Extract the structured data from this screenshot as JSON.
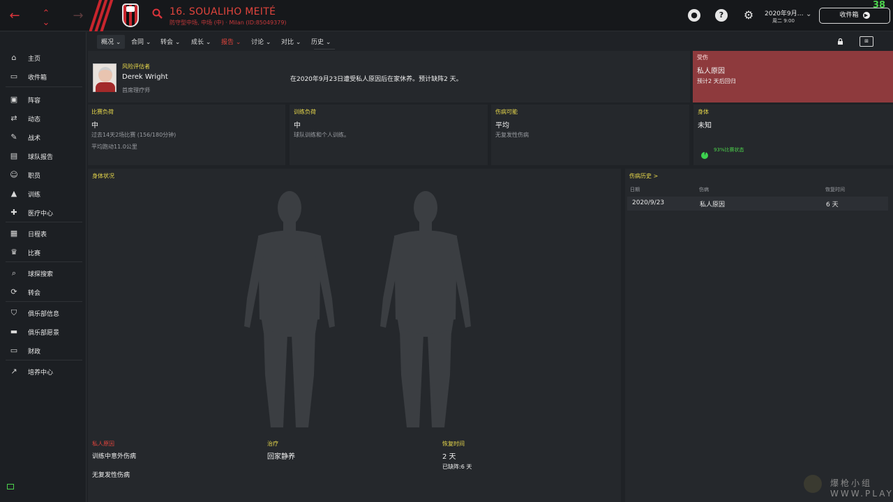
{
  "header": {
    "player_name": "16. SOUALIHO MEITÉ",
    "player_subtitle": "防守型中场, 中场 (中) · Milan (ID:85049379)",
    "date": "2020年9月…",
    "weekday_time": "周二 9:00",
    "inbox_label": "收件箱",
    "counter": "38",
    "icons": [
      "back-arrow-icon",
      "up-down-arrow-icon",
      "forward-arrow-icon",
      "club-crest",
      "search-icon",
      "ball-icon",
      "help-icon",
      "settings-gear-icon"
    ]
  },
  "sidebar": {
    "items": [
      {
        "label": "主页",
        "icon": "home-icon"
      },
      {
        "label": "收件箱",
        "icon": "inbox-icon"
      },
      {
        "label": "阵容",
        "icon": "shirt-icon"
      },
      {
        "label": "动态",
        "icon": "dynamics-icon"
      },
      {
        "label": "战术",
        "icon": "tactics-icon"
      },
      {
        "label": "球队报告",
        "icon": "report-icon"
      },
      {
        "label": "职员",
        "icon": "staff-icon"
      },
      {
        "label": "训练",
        "icon": "training-icon"
      },
      {
        "label": "医疗中心",
        "icon": "medical-icon"
      },
      {
        "label": "日程表",
        "icon": "calendar-icon"
      },
      {
        "label": "比赛",
        "icon": "trophy-icon"
      },
      {
        "label": "球探搜索",
        "icon": "scout-search-icon"
      },
      {
        "label": "转会",
        "icon": "transfer-icon"
      },
      {
        "label": "俱乐部信息",
        "icon": "shield-icon"
      },
      {
        "label": "俱乐部愿景",
        "icon": "briefcase-icon"
      },
      {
        "label": "财政",
        "icon": "money-icon"
      },
      {
        "label": "培养中心",
        "icon": "development-icon"
      }
    ]
  },
  "tabs": [
    {
      "label": "概况",
      "active": false
    },
    {
      "label": "合同",
      "active": false
    },
    {
      "label": "转会",
      "active": false
    },
    {
      "label": "成长",
      "active": false
    },
    {
      "label": "报告",
      "active": true
    },
    {
      "label": "讨论",
      "active": false
    },
    {
      "label": "对比",
      "active": false
    },
    {
      "label": "历史",
      "active": false
    }
  ],
  "assessor": {
    "label": "风险评估者",
    "name": "Derek Wright",
    "role": "首席理疗师",
    "message": "在2020年9月23日遭受私人原因后在家休养。预计缺阵2 天。"
  },
  "injury_card": {
    "label": "受伤",
    "title": "私人原因",
    "detail": "预计2 天后回归",
    "color": "#8e3a3d"
  },
  "stats": {
    "match_load": {
      "label": "比赛负荷",
      "value": "中",
      "line1": "过去14天2场比赛 (156/180分钟)",
      "line2": "平均跑动11.0公里"
    },
    "training_load": {
      "label": "训练负荷",
      "value": "中",
      "line1": "球队训练和个人训练。"
    },
    "injury_risk": {
      "label": "伤病可能",
      "value": "平均",
      "line1": "无复发性伤病"
    },
    "body": {
      "label": "身体",
      "value": "未知",
      "condition": "93%比赛状态",
      "condition_percent": 93
    }
  },
  "body_status": {
    "label": "身体状况",
    "cause_label": "私人原因",
    "cause_value": "训练中意外伤病",
    "recurrence": "无复发性伤病",
    "treatment_label": "治疗",
    "treatment_value": "回家静养",
    "recovery_label": "恢复时间",
    "recovery_value": "2 天",
    "missed": "已缺阵:6 天"
  },
  "history": {
    "title": "伤病历史 >",
    "columns": [
      "日期",
      "伤病",
      "恢复时间"
    ],
    "rows": [
      {
        "date": "2020/9/23",
        "injury": "私人原因",
        "recovery": "6 天"
      }
    ]
  },
  "watermark": "爆枪小组 WWW.PLAYGM.CC"
}
